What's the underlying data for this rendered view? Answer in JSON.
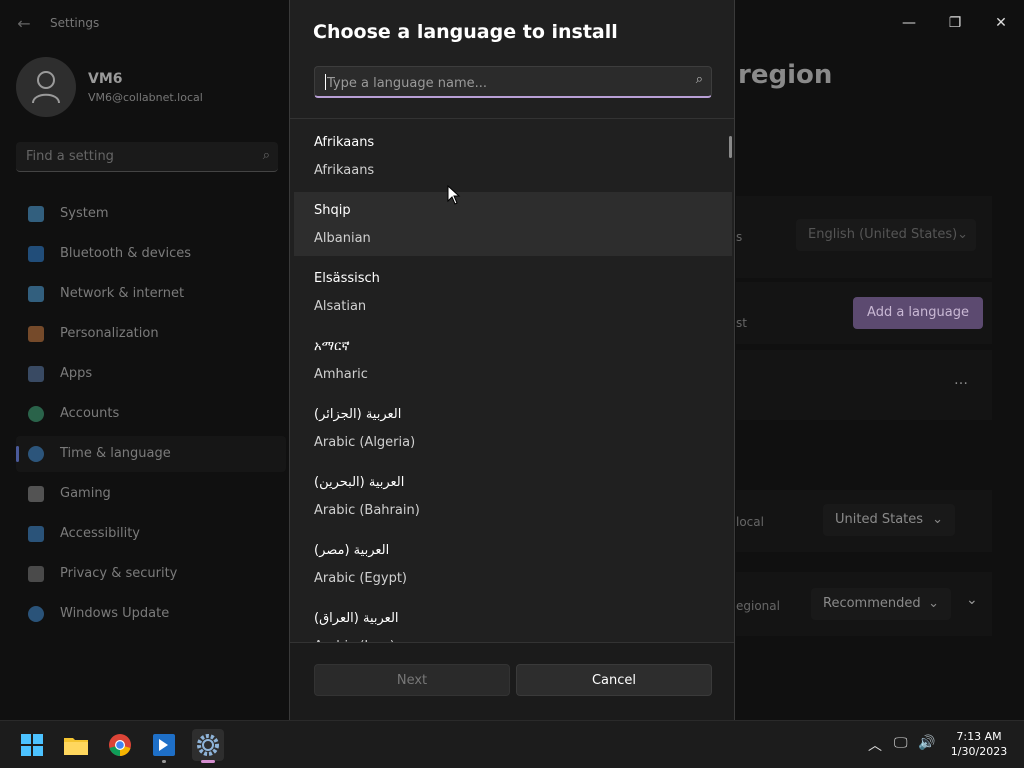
{
  "settings": {
    "title": "Settings",
    "user": {
      "name": "VM6",
      "email": "VM6@collabnet.local"
    },
    "find_placeholder": "Find a setting",
    "nav": [
      {
        "label": "System",
        "color": "#4fa0d8"
      },
      {
        "label": "Bluetooth & devices",
        "color": "#2f7fd0"
      },
      {
        "label": "Network & internet",
        "color": "#4fa0d8"
      },
      {
        "label": "Personalization",
        "color": "#c87a40"
      },
      {
        "label": "Apps",
        "color": "#5b7aa8"
      },
      {
        "label": "Accounts",
        "color": "#3fa87a"
      },
      {
        "label": "Time & language",
        "color": "#3f8ad0"
      },
      {
        "label": "Gaming",
        "color": "#8a8a8a"
      },
      {
        "label": "Accessibility",
        "color": "#3f8ad0"
      },
      {
        "label": "Privacy & security",
        "color": "#7a7a7a"
      },
      {
        "label": "Windows Update",
        "color": "#3f8ad0"
      }
    ],
    "page_title_fragment": "region",
    "display_language_value": "English (United States)",
    "add_language_label": "Add a language",
    "more_icon": "…",
    "country_value": "United States",
    "regional_format_value": "Recommended",
    "fragment_s": "s",
    "fragment_st": "st",
    "fragment_local": "local",
    "fragment_regional": "egional"
  },
  "dialog": {
    "title": "Choose a language to install",
    "search_placeholder": "Type a language name...",
    "languages": [
      {
        "native": "Afrikaans",
        "english": "Afrikaans"
      },
      {
        "native": "Shqip",
        "english": "Albanian"
      },
      {
        "native": "Elsässisch",
        "english": "Alsatian"
      },
      {
        "native": "አማርኛ",
        "english": "Amharic"
      },
      {
        "native": "العربية (الجزائر)",
        "english": "Arabic (Algeria)"
      },
      {
        "native": "العربية (البحرين)",
        "english": "Arabic (Bahrain)"
      },
      {
        "native": "العربية (مصر)",
        "english": "Arabic (Egypt)"
      },
      {
        "native": "العربية (العراق)",
        "english": "Arabic (Iraq)"
      }
    ],
    "next_label": "Next",
    "cancel_label": "Cancel"
  },
  "taskbar": {
    "time": "7:13 AM",
    "date": "1/30/2023"
  },
  "colors": {
    "accent": "#b9a0d6",
    "dialog_bg": "#202020",
    "hover_row": "#2d2d2d"
  }
}
